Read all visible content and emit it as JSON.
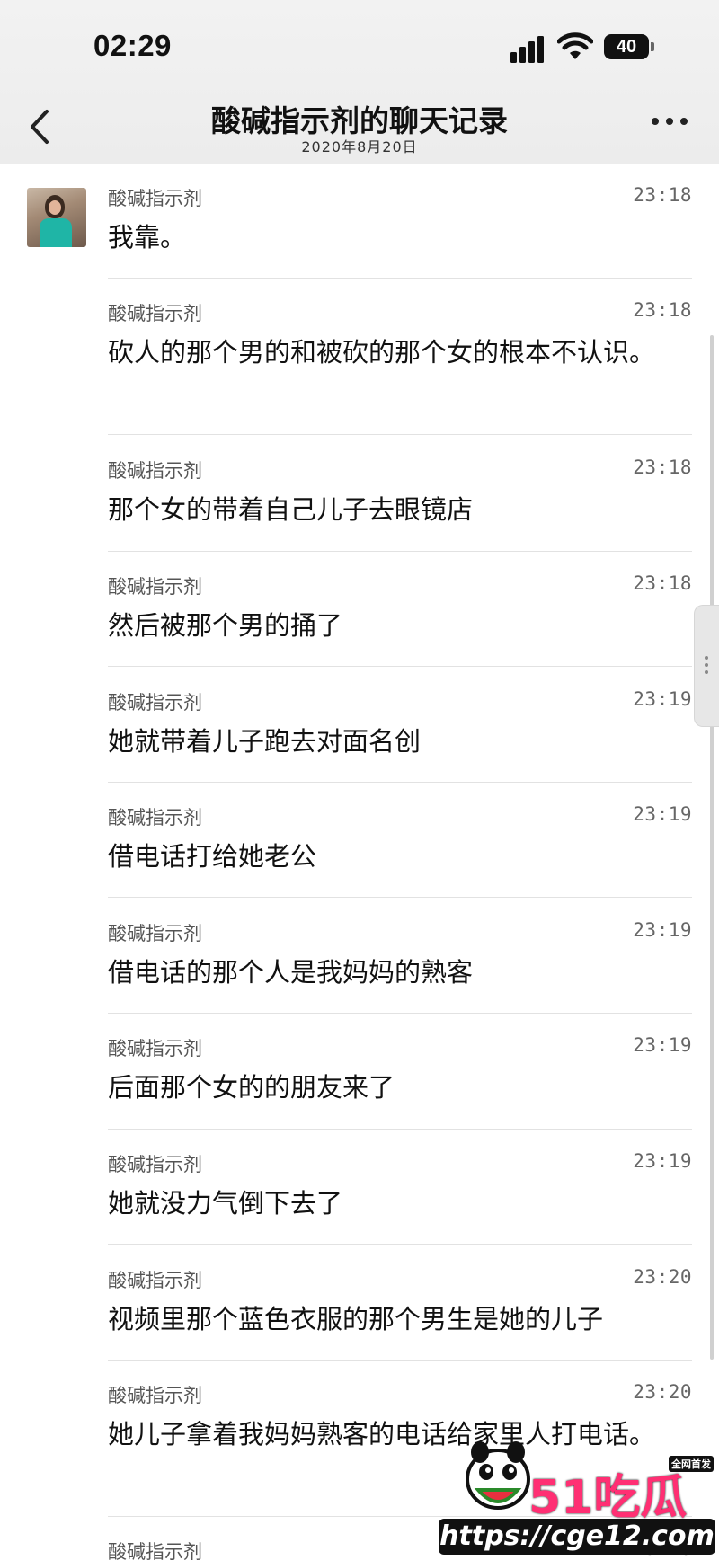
{
  "status_bar": {
    "time": "02:29",
    "battery": "40",
    "icons": [
      "signal-icon",
      "wifi-icon",
      "battery-icon"
    ]
  },
  "nav": {
    "back_icon": "chevron-left-icon",
    "title": "酸碱指示剂的聊天记录",
    "subtitle": "2020年8月20日",
    "more_icon": "more-icon"
  },
  "messages": [
    {
      "sender": "酸碱指示剂",
      "time": "23:18",
      "text": "我靠。"
    },
    {
      "sender": "酸碱指示剂",
      "time": "23:18",
      "text": "砍人的那个男的和被砍的那个女的根本不认识。"
    },
    {
      "sender": "酸碱指示剂",
      "time": "23:18",
      "text": "那个女的带着自己儿子去眼镜店"
    },
    {
      "sender": "酸碱指示剂",
      "time": "23:18",
      "text": "然后被那个男的捅了"
    },
    {
      "sender": "酸碱指示剂",
      "time": "23:19",
      "text": "她就带着儿子跑去对面名创"
    },
    {
      "sender": "酸碱指示剂",
      "time": "23:19",
      "text": "借电话打给她老公"
    },
    {
      "sender": "酸碱指示剂",
      "time": "23:19",
      "text": "借电话的那个人是我妈妈的熟客"
    },
    {
      "sender": "酸碱指示剂",
      "time": "23:19",
      "text": "后面那个女的的朋友来了"
    },
    {
      "sender": "酸碱指示剂",
      "time": "23:19",
      "text": "她就没力气倒下去了"
    },
    {
      "sender": "酸碱指示剂",
      "time": "23:20",
      "text": "视频里那个蓝色衣服的那个男生是她的儿子"
    },
    {
      "sender": "酸碱指示剂",
      "time": "23:20",
      "text": "她儿子拿着我妈妈熟客的电话给家里人打电话。"
    },
    {
      "sender": "酸碱指示剂",
      "time": "23:20",
      "text": ""
    }
  ],
  "watermark": {
    "brand": "51吃瓜",
    "tag": "全网首发",
    "url": "https://cge12.com"
  }
}
